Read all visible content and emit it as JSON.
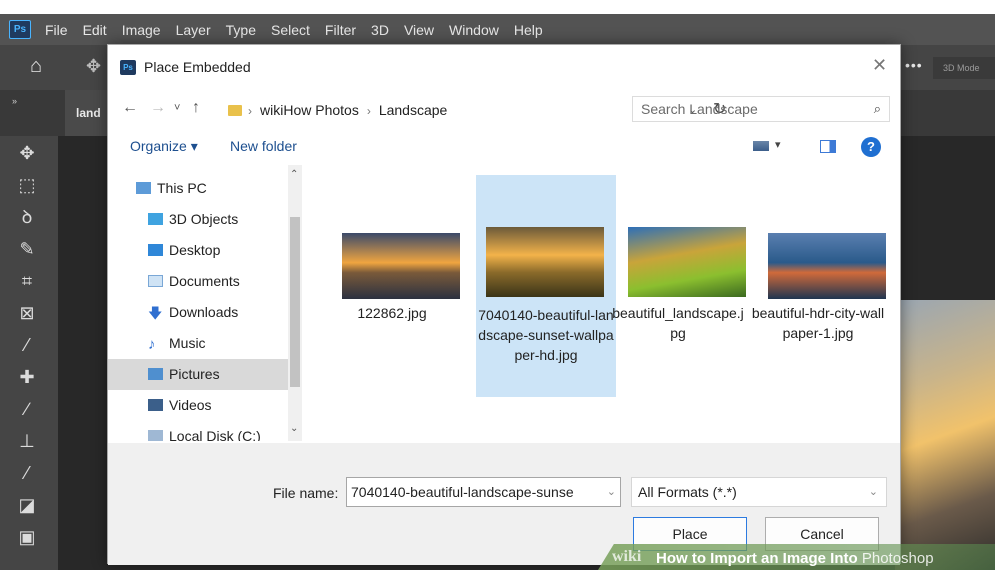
{
  "photoshop": {
    "logo": "Ps",
    "menus": [
      "File",
      "Edit",
      "Image",
      "Layer",
      "Type",
      "Select",
      "Filter",
      "3D",
      "View",
      "Window",
      "Help"
    ],
    "doc_tab": "land",
    "options_mode": "3D Mode",
    "collapse": "»"
  },
  "dialog": {
    "title": "Place Embedded",
    "close": "✕",
    "nav": {
      "back": "←",
      "forward": "→",
      "recent": "˅",
      "up": "↑",
      "breadcrumb": [
        "wikiHow Photos",
        "Landscape"
      ],
      "refresh": "↻",
      "search_placeholder": "Search Landscape"
    },
    "toolbar": {
      "organize": "Organize ▾",
      "new_folder": "New folder",
      "help": "?"
    },
    "nav_pane": [
      {
        "label": "This PC",
        "icon": "pc-icon"
      },
      {
        "label": "3D Objects",
        "icon": "3d-objects-icon"
      },
      {
        "label": "Desktop",
        "icon": "desktop-icon"
      },
      {
        "label": "Documents",
        "icon": "documents-icon"
      },
      {
        "label": "Downloads",
        "icon": "downloads-icon"
      },
      {
        "label": "Music",
        "icon": "music-icon"
      },
      {
        "label": "Pictures",
        "icon": "pictures-icon",
        "selected": true
      },
      {
        "label": "Videos",
        "icon": "videos-icon"
      },
      {
        "label": "Local Disk (C:)",
        "icon": "disk-icon"
      }
    ],
    "files": [
      {
        "name": "122862.jpg",
        "selected": false
      },
      {
        "name": "7040140-beautiful-landscape-sunset-wallpaper-hd.jpg",
        "selected": true
      },
      {
        "name": "beautiful_landscape.jpg",
        "selected": false
      },
      {
        "name": "beautiful-hdr-city-wallpaper-1.jpg",
        "selected": false
      }
    ],
    "bottom": {
      "file_name_label": "File name:",
      "file_name_value": "7040140-beautiful-landscape-sunse",
      "file_type": "All Formats (*.*)",
      "place": "Place",
      "cancel": "Cancel"
    }
  },
  "watermark": {
    "wiki": "wiki",
    "text_bold": "How to Import an Image Into ",
    "text_tail": "Photoshop"
  },
  "colors": {
    "selection": "#cce4f7",
    "link": "#1d4f8f",
    "ps_panel": "#535353"
  }
}
